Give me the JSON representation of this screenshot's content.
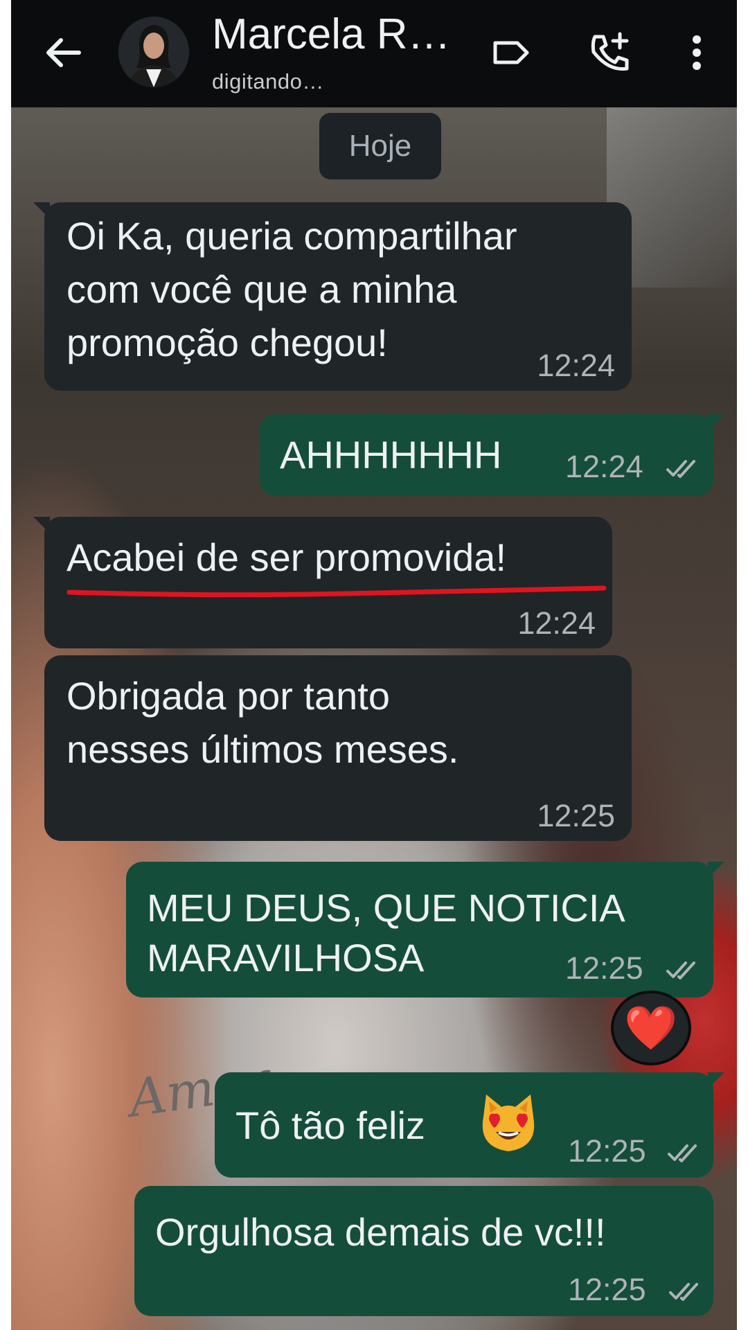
{
  "header": {
    "back_icon": "arrow-left-icon",
    "contact_name": "Marcela R…",
    "status": "digitando…",
    "label_icon": "label-tag-icon",
    "call_icon": "add-call-icon",
    "menu_icon": "more-vertical-icon"
  },
  "chat": {
    "date": "Hoje",
    "messages": [
      {
        "direction": "in",
        "lines": [
          "Oi Ka, queria compartilhar",
          "com você que a minha",
          "promoção chegou!"
        ],
        "time": "12:24"
      },
      {
        "direction": "out",
        "lines": [
          "AHHHHHHH"
        ],
        "time": "12:24",
        "status": "read"
      },
      {
        "direction": "in",
        "lines": [
          "Acabei de ser promovida!"
        ],
        "time": "12:24",
        "annotation": "red-underline"
      },
      {
        "direction": "in",
        "lines": [
          "Obrigada por tanto",
          "nesses últimos meses."
        ],
        "time": "12:25"
      },
      {
        "direction": "out",
        "lines": [
          "MEU DEUS, QUE NOTICIA",
          "MARAVILHOSA"
        ],
        "time": "12:25",
        "status": "read",
        "reaction": "❤️"
      },
      {
        "direction": "out",
        "lines": [
          "Tô tão feliz"
        ],
        "emoji": "😻",
        "time": "12:25",
        "status": "read"
      },
      {
        "direction": "out",
        "lines": [
          "Orgulhosa demais de vc!!!"
        ],
        "time": "12:25",
        "status": "read"
      }
    ]
  },
  "background": {
    "mug_text": "Amor"
  },
  "colors": {
    "header_bg": "#0b0c0d",
    "incoming_bubble": "#202528",
    "outgoing_bubble": "#154d3b",
    "annotation_red": "#e0141e"
  }
}
